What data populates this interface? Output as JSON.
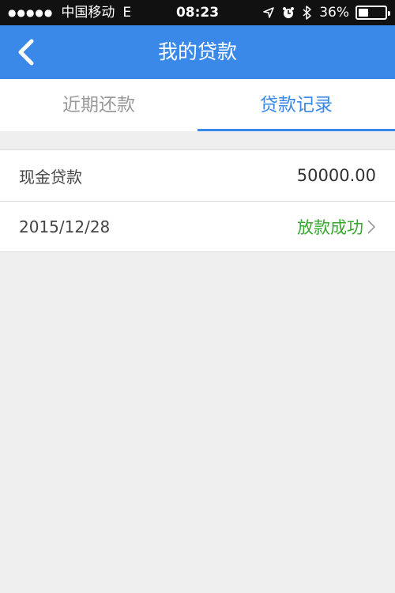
{
  "status_bar": {
    "signal_dots": "●●●●●",
    "carrier": "中国移动",
    "network": "E",
    "time": "08:23",
    "battery": "36%",
    "battery_level": 0.36,
    "icons": [
      "location-arrow-icon",
      "alarm-icon",
      "bluetooth-icon",
      "battery-icon"
    ]
  },
  "nav": {
    "title": "我的贷款",
    "back_icon": "chevron-left-icon"
  },
  "tabs": [
    {
      "label": "近期还款",
      "active": false
    },
    {
      "label": "贷款记录",
      "active": true
    }
  ],
  "record": {
    "type_label": "现金贷款",
    "amount": "50000.00",
    "date": "2015/12/28",
    "status": "放款成功",
    "status_color": "#37a82e"
  },
  "colors": {
    "accent": "#3a89e8",
    "background": "#efefef"
  }
}
